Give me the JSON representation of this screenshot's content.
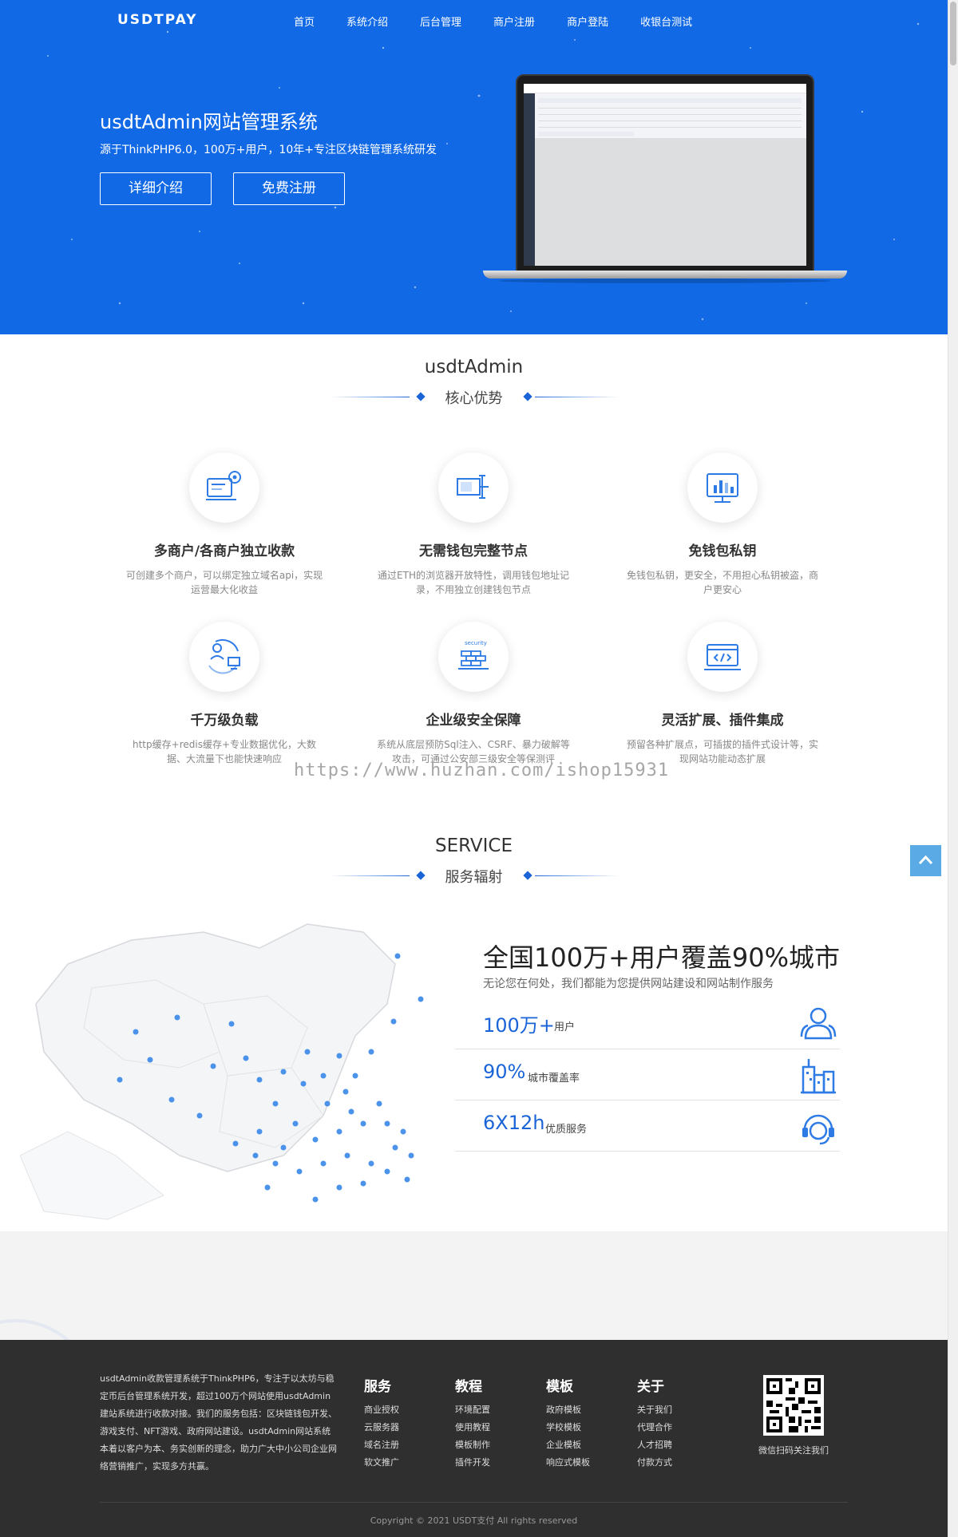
{
  "nav": {
    "logo": "USDTPAY",
    "links": [
      "首页",
      "系统介绍",
      "后台管理",
      "商户注册",
      "商户登陆",
      "收银台测试"
    ]
  },
  "hero": {
    "title": "usdtAdmin网站管理系统",
    "subtitle": "源于ThinkPHP6.0，100万+用户，10年+专注区块链管理系统研发",
    "btn_detail": "详细介绍",
    "btn_register": "免费注册"
  },
  "advantages": {
    "title_en": "usdtAdmin",
    "title_cn": "核心优势",
    "items": [
      {
        "title": "多商户/各商户独立收款",
        "desc": "可创建多个商户，可以绑定独立域名api，实现运营最大化收益",
        "icon": "merchant-settings-icon"
      },
      {
        "title": "无需钱包完整节点",
        "desc": "通过ETH的浏览器开放特性，调用钱包地址记录，不用独立创建钱包节点",
        "icon": "node-icon"
      },
      {
        "title": "免钱包私钥",
        "desc": "免钱包私钥，更安全，不用担心私钥被盗，商户更安心",
        "icon": "monitor-chart-icon"
      },
      {
        "title": "千万级负载",
        "desc": "http缓存+redis缓存+专业数据优化，大数据、大流量下也能快速响应",
        "icon": "load-balance-icon"
      },
      {
        "title": "企业级安全保障",
        "desc": "系统从底层预防Sql注入、CSRF、暴力破解等攻击，可通过公安部三级安全等保测评",
        "icon": "security-wall-icon"
      },
      {
        "title": "灵活扩展、插件集成",
        "desc": "预留各种扩展点，可插拔的插件式设计等，实现网站功能动态扩展",
        "icon": "code-window-icon"
      }
    ]
  },
  "watermark": "https://www.huzhan.com/ishop15931",
  "service": {
    "title_en": "SERVICE",
    "title_cn": "服务辐射",
    "headline": "全国100万+用户覆盖90%城市",
    "subline": "无论您在何处，我们都能为您提供网站建设和网站制作服务",
    "stats": [
      {
        "value": "100万+",
        "label": "用户",
        "icon": "users-icon"
      },
      {
        "value": "90%",
        "label": "城市覆盖率",
        "icon": "buildings-icon"
      },
      {
        "value": "6X12h",
        "label": "优质服务",
        "icon": "headset-icon"
      }
    ]
  },
  "footer": {
    "about": "usdtAdmin收款管理系统于ThinkPHP6，专注于以太坊与稳定币后台管理系统开发，超过100万个网站使用usdtAdmin建站系统进行收款对接。我们的服务包括：区块链钱包开发、游戏支付、NFT游戏、政府网站建设。usdtAdmin网站系统本着以客户为本、务实创新的理念，助力广大中小公司企业网络营销推广，实现多方共赢。",
    "columns": [
      {
        "title": "服务",
        "items": [
          "商业授权",
          "云服务器",
          "域名注册",
          "软文推广"
        ]
      },
      {
        "title": "教程",
        "items": [
          "环境配置",
          "使用教程",
          "模板制作",
          "插件开发"
        ]
      },
      {
        "title": "模板",
        "items": [
          "政府模板",
          "学校模板",
          "企业模板",
          "响应式模板"
        ]
      },
      {
        "title": "关于",
        "items": [
          "关于我们",
          "代理合作",
          "人才招聘",
          "付款方式"
        ]
      }
    ],
    "qr_caption": "微信扫码关注我们",
    "copyright": "Copyright © 2021 USDT支付 All rights reserved"
  },
  "colors": {
    "hero_bg": "#1169e6",
    "accent": "#1a64d8",
    "footer_bg": "#2f2f2f",
    "to_top": "#5aaae6"
  }
}
